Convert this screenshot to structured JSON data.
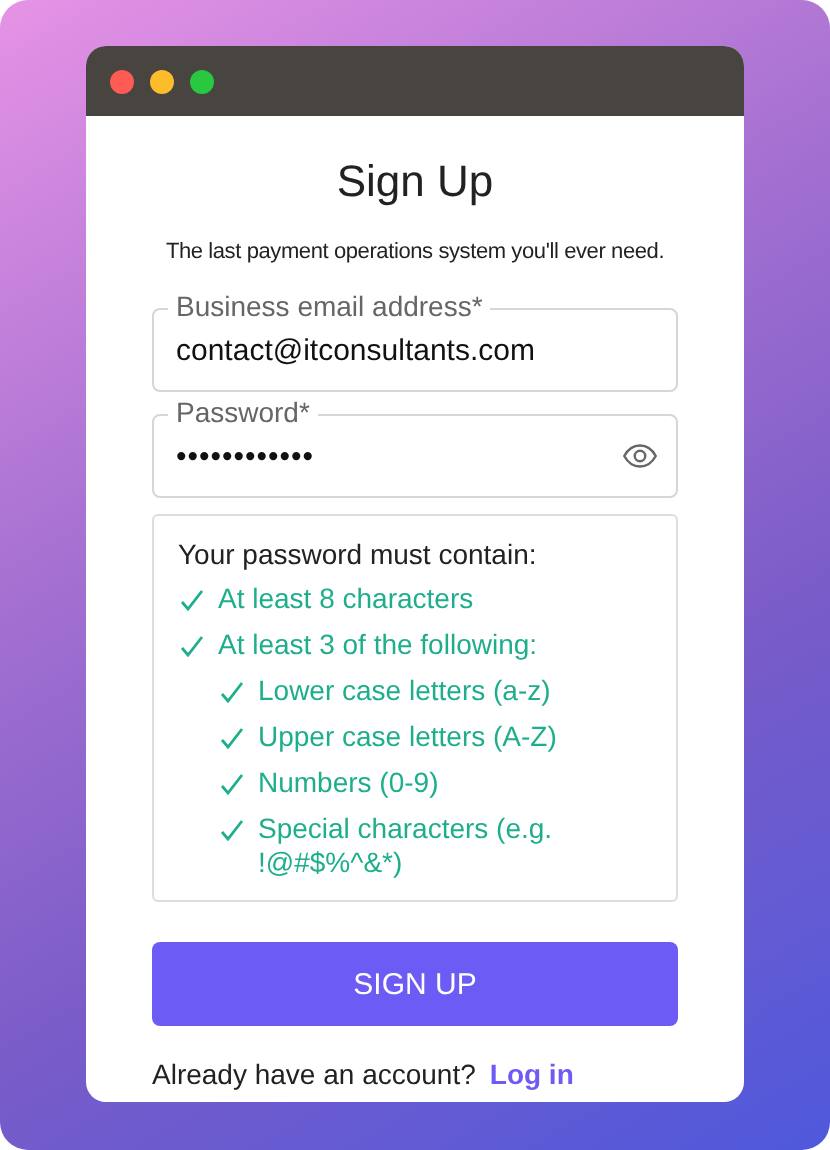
{
  "title": "Sign Up",
  "subtitle": "The last payment operations system you'll ever need.",
  "fields": [
    {
      "label": "Business email address*",
      "value": "contact@itconsultants.com",
      "kind": "text"
    },
    {
      "label": "Password*",
      "value": "••••••••••••",
      "kind": "password"
    }
  ],
  "requirements": {
    "heading": "Your password must contain:",
    "items": [
      {
        "text": "At least 8 characters",
        "met": true
      },
      {
        "text": "At least 3 of the following:",
        "met": true,
        "children": [
          {
            "text": "Lower case letters (a-z)",
            "met": true
          },
          {
            "text": "Upper case letters (A-Z)",
            "met": true
          },
          {
            "text": "Numbers (0-9)",
            "met": true
          },
          {
            "text": "Special characters (e.g. !@#$%^&*)",
            "met": true
          }
        ]
      }
    ]
  },
  "button": "SIGN UP",
  "footer": {
    "text": "Already have an account?",
    "link": "Log in"
  }
}
